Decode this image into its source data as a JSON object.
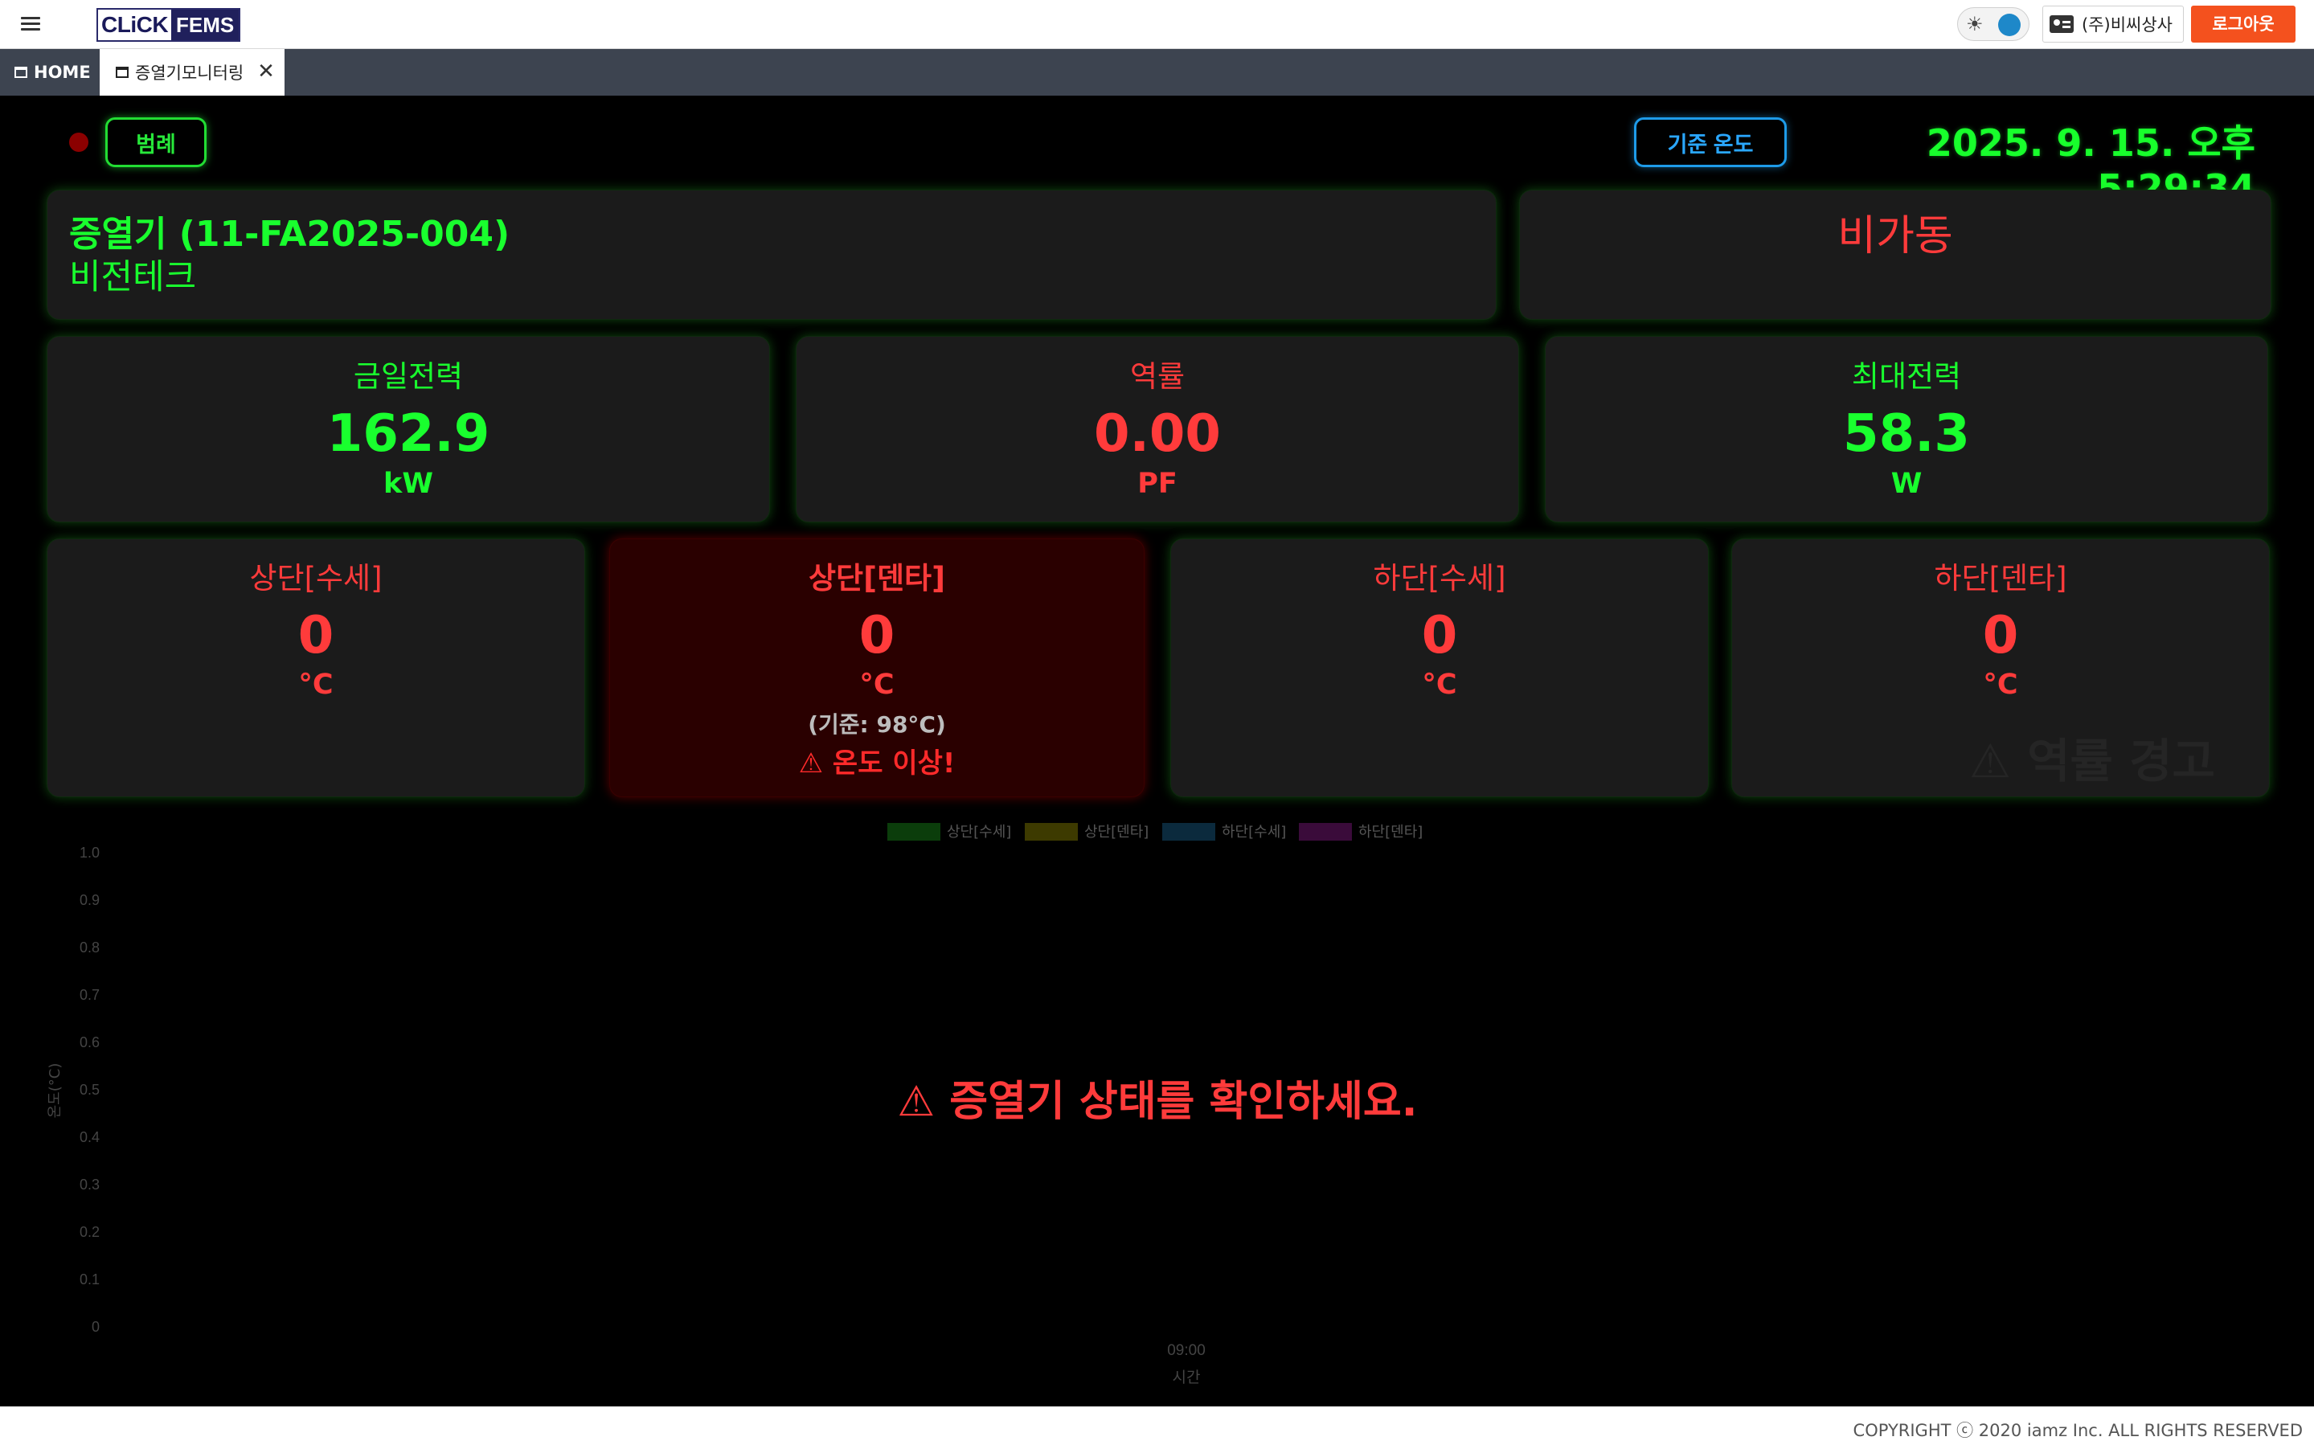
{
  "header": {
    "logo_left": "CLiCK",
    "logo_right": "FEMS",
    "user_name": "(주)비씨상사",
    "logout_label": "로그아웃"
  },
  "tabs": {
    "home_label": "HOME",
    "active_label": "증열기모니터링",
    "close_glyph": "✕"
  },
  "toolbar": {
    "legend_label": "범례",
    "ref_temp_label": "기준 온도",
    "datetime": "2025. 9. 15. 오후 5:29:34",
    "status_dot_color": "#8b0000"
  },
  "device": {
    "title": "증열기 (11-FA2025-004)",
    "company": "비전테크",
    "operation_status": "비가동"
  },
  "metrics": [
    {
      "label": "금일전력",
      "value": "162.9",
      "unit": "kW",
      "color": "green"
    },
    {
      "label": "역률",
      "value": "0.00",
      "unit": "PF",
      "color": "red"
    },
    {
      "label": "최대전력",
      "value": "58.3",
      "unit": "W",
      "color": "green"
    }
  ],
  "temps": [
    {
      "label": "상단[수세]",
      "value": "0",
      "unit": "°C"
    },
    {
      "label": "상단[덴타]",
      "value": "0",
      "unit": "°C",
      "reference": "(기준: 98°C)",
      "warning": "⚠ 온도 이상!"
    },
    {
      "label": "하단[수세]",
      "value": "0",
      "unit": "°C"
    },
    {
      "label": "하단[덴타]",
      "value": "0",
      "unit": "°C",
      "ghost_warning": "⚠ 역률 경고"
    }
  ],
  "chart_data": {
    "type": "line",
    "title": "",
    "xlabel": "시간",
    "ylabel": "온도(°C)",
    "x": [
      "09:00"
    ],
    "ylim": [
      0,
      1
    ],
    "yticks": [
      "0",
      "0.1",
      "0.2",
      "0.3",
      "0.4",
      "0.5",
      "0.6",
      "0.7",
      "0.8",
      "0.9",
      "1.0"
    ],
    "series": [
      {
        "name": "상단[수세]",
        "values": [],
        "color": "#0b3d0b"
      },
      {
        "name": "상단[덴타]",
        "values": [],
        "color": "#3d3a00"
      },
      {
        "name": "하단[수세]",
        "values": [],
        "color": "#0b2a3d"
      },
      {
        "name": "하단[덴타]",
        "values": [],
        "color": "#3a0b3a"
      }
    ],
    "legend": "top-center",
    "grid": false
  },
  "overlay": {
    "message": "⚠ 증열기 상태를 확인하세요."
  },
  "footer": {
    "copyright": "COPYRIGHT ⓒ 2020 iamz Inc. ALL RIGHTS RESERVED"
  }
}
